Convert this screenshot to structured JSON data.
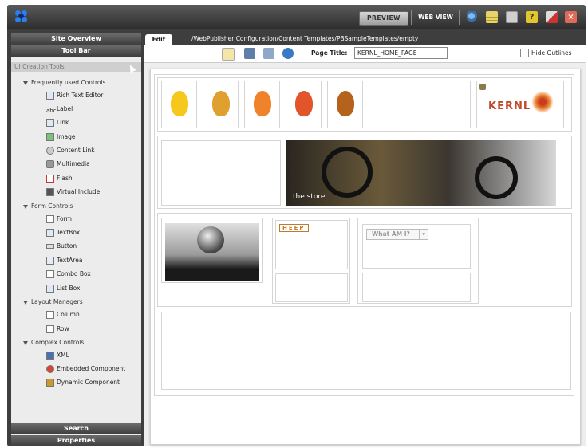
{
  "topbar": {
    "preview_label": "PREVIEW",
    "webview_label": "WEB VIEW",
    "icons": [
      "app-logo",
      "settings-icon",
      "list-icon",
      "grid-icon",
      "help-icon",
      "export-icon",
      "close-icon"
    ]
  },
  "left_panel": {
    "site_overview": "Site Overview",
    "toolbar_header": "Tool Bar",
    "ui_creation_tools": "UI Creation Tools",
    "search_label": "Search",
    "properties_label": "Properties",
    "groups": [
      {
        "label": "Frequently used Controls",
        "items": [
          "Rich Text Editor",
          "Label",
          "Link",
          "Image",
          "Content Link",
          "Multimedia",
          "Flash",
          "Virtual Include"
        ]
      },
      {
        "label": "Form Controls",
        "items": [
          "Form",
          "TextBox",
          "Button",
          "TextArea",
          "Combo Box",
          "List Box"
        ]
      },
      {
        "label": "Layout Managers",
        "items": [
          "Column",
          "Row"
        ]
      },
      {
        "label": "Complex Controls",
        "items": [
          "XML",
          "Embedded Component",
          "Dynamic Component"
        ]
      }
    ]
  },
  "editor": {
    "tab_label": "Edit",
    "path": "/WebPublisher Configuration/Content Templates/PBSampleTemplates/empty",
    "page_title_label": "Page Title:",
    "page_title_value": "KERNL_HOME_PAGE",
    "hide_outlines_label": "Hide Outlines"
  },
  "canvas": {
    "logo_text": "KERNL",
    "store_text": "the store",
    "heep_text": "HEEP",
    "dropdown_text": "What AM I?",
    "balloon_colors": [
      "#f7c81c",
      "#e0a030",
      "#f0832a",
      "#e2552a",
      "#b5621c"
    ]
  }
}
